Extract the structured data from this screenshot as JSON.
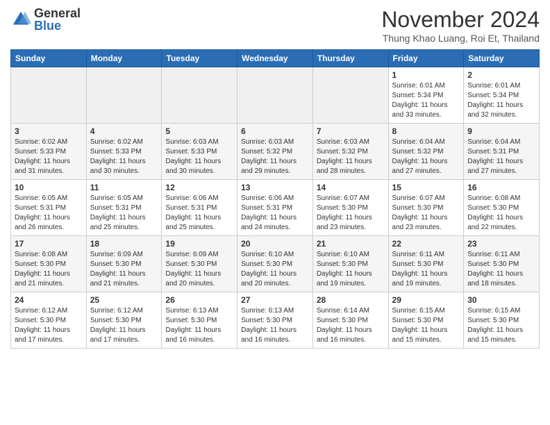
{
  "logo": {
    "general": "General",
    "blue": "Blue"
  },
  "header": {
    "month": "November 2024",
    "location": "Thung Khao Luang, Roi Et, Thailand"
  },
  "weekdays": [
    "Sunday",
    "Monday",
    "Tuesday",
    "Wednesday",
    "Thursday",
    "Friday",
    "Saturday"
  ],
  "weeks": [
    [
      {
        "day": "",
        "empty": true
      },
      {
        "day": "",
        "empty": true
      },
      {
        "day": "",
        "empty": true
      },
      {
        "day": "",
        "empty": true
      },
      {
        "day": "",
        "empty": true
      },
      {
        "day": "1",
        "sunrise": "Sunrise: 6:01 AM",
        "sunset": "Sunset: 5:34 PM",
        "daylight": "Daylight: 11 hours and 33 minutes."
      },
      {
        "day": "2",
        "sunrise": "Sunrise: 6:01 AM",
        "sunset": "Sunset: 5:34 PM",
        "daylight": "Daylight: 11 hours and 32 minutes."
      }
    ],
    [
      {
        "day": "3",
        "sunrise": "Sunrise: 6:02 AM",
        "sunset": "Sunset: 5:33 PM",
        "daylight": "Daylight: 11 hours and 31 minutes."
      },
      {
        "day": "4",
        "sunrise": "Sunrise: 6:02 AM",
        "sunset": "Sunset: 5:33 PM",
        "daylight": "Daylight: 11 hours and 30 minutes."
      },
      {
        "day": "5",
        "sunrise": "Sunrise: 6:03 AM",
        "sunset": "Sunset: 5:33 PM",
        "daylight": "Daylight: 11 hours and 30 minutes."
      },
      {
        "day": "6",
        "sunrise": "Sunrise: 6:03 AM",
        "sunset": "Sunset: 5:32 PM",
        "daylight": "Daylight: 11 hours and 29 minutes."
      },
      {
        "day": "7",
        "sunrise": "Sunrise: 6:03 AM",
        "sunset": "Sunset: 5:32 PM",
        "daylight": "Daylight: 11 hours and 28 minutes."
      },
      {
        "day": "8",
        "sunrise": "Sunrise: 6:04 AM",
        "sunset": "Sunset: 5:32 PM",
        "daylight": "Daylight: 11 hours and 27 minutes."
      },
      {
        "day": "9",
        "sunrise": "Sunrise: 6:04 AM",
        "sunset": "Sunset: 5:31 PM",
        "daylight": "Daylight: 11 hours and 27 minutes."
      }
    ],
    [
      {
        "day": "10",
        "sunrise": "Sunrise: 6:05 AM",
        "sunset": "Sunset: 5:31 PM",
        "daylight": "Daylight: 11 hours and 26 minutes."
      },
      {
        "day": "11",
        "sunrise": "Sunrise: 6:05 AM",
        "sunset": "Sunset: 5:31 PM",
        "daylight": "Daylight: 11 hours and 25 minutes."
      },
      {
        "day": "12",
        "sunrise": "Sunrise: 6:06 AM",
        "sunset": "Sunset: 5:31 PM",
        "daylight": "Daylight: 11 hours and 25 minutes."
      },
      {
        "day": "13",
        "sunrise": "Sunrise: 6:06 AM",
        "sunset": "Sunset: 5:31 PM",
        "daylight": "Daylight: 11 hours and 24 minutes."
      },
      {
        "day": "14",
        "sunrise": "Sunrise: 6:07 AM",
        "sunset": "Sunset: 5:30 PM",
        "daylight": "Daylight: 11 hours and 23 minutes."
      },
      {
        "day": "15",
        "sunrise": "Sunrise: 6:07 AM",
        "sunset": "Sunset: 5:30 PM",
        "daylight": "Daylight: 11 hours and 23 minutes."
      },
      {
        "day": "16",
        "sunrise": "Sunrise: 6:08 AM",
        "sunset": "Sunset: 5:30 PM",
        "daylight": "Daylight: 11 hours and 22 minutes."
      }
    ],
    [
      {
        "day": "17",
        "sunrise": "Sunrise: 6:08 AM",
        "sunset": "Sunset: 5:30 PM",
        "daylight": "Daylight: 11 hours and 21 minutes."
      },
      {
        "day": "18",
        "sunrise": "Sunrise: 6:09 AM",
        "sunset": "Sunset: 5:30 PM",
        "daylight": "Daylight: 11 hours and 21 minutes."
      },
      {
        "day": "19",
        "sunrise": "Sunrise: 6:09 AM",
        "sunset": "Sunset: 5:30 PM",
        "daylight": "Daylight: 11 hours and 20 minutes."
      },
      {
        "day": "20",
        "sunrise": "Sunrise: 6:10 AM",
        "sunset": "Sunset: 5:30 PM",
        "daylight": "Daylight: 11 hours and 20 minutes."
      },
      {
        "day": "21",
        "sunrise": "Sunrise: 6:10 AM",
        "sunset": "Sunset: 5:30 PM",
        "daylight": "Daylight: 11 hours and 19 minutes."
      },
      {
        "day": "22",
        "sunrise": "Sunrise: 6:11 AM",
        "sunset": "Sunset: 5:30 PM",
        "daylight": "Daylight: 11 hours and 19 minutes."
      },
      {
        "day": "23",
        "sunrise": "Sunrise: 6:11 AM",
        "sunset": "Sunset: 5:30 PM",
        "daylight": "Daylight: 11 hours and 18 minutes."
      }
    ],
    [
      {
        "day": "24",
        "sunrise": "Sunrise: 6:12 AM",
        "sunset": "Sunset: 5:30 PM",
        "daylight": "Daylight: 11 hours and 17 minutes."
      },
      {
        "day": "25",
        "sunrise": "Sunrise: 6:12 AM",
        "sunset": "Sunset: 5:30 PM",
        "daylight": "Daylight: 11 hours and 17 minutes."
      },
      {
        "day": "26",
        "sunrise": "Sunrise: 6:13 AM",
        "sunset": "Sunset: 5:30 PM",
        "daylight": "Daylight: 11 hours and 16 minutes."
      },
      {
        "day": "27",
        "sunrise": "Sunrise: 6:13 AM",
        "sunset": "Sunset: 5:30 PM",
        "daylight": "Daylight: 11 hours and 16 minutes."
      },
      {
        "day": "28",
        "sunrise": "Sunrise: 6:14 AM",
        "sunset": "Sunset: 5:30 PM",
        "daylight": "Daylight: 11 hours and 16 minutes."
      },
      {
        "day": "29",
        "sunrise": "Sunrise: 6:15 AM",
        "sunset": "Sunset: 5:30 PM",
        "daylight": "Daylight: 11 hours and 15 minutes."
      },
      {
        "day": "30",
        "sunrise": "Sunrise: 6:15 AM",
        "sunset": "Sunset: 5:30 PM",
        "daylight": "Daylight: 11 hours and 15 minutes."
      }
    ]
  ]
}
